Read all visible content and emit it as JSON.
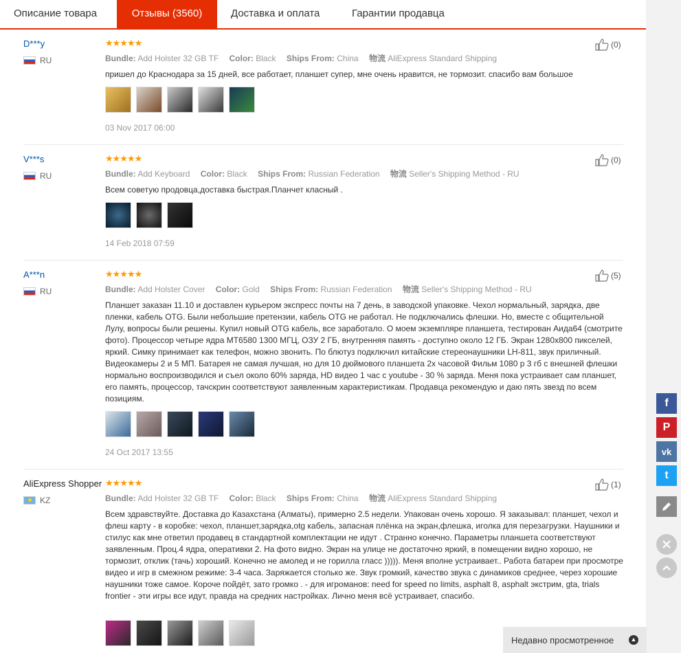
{
  "tabs": [
    {
      "label": "Описание товара"
    },
    {
      "label": "Отзывы (3560)"
    },
    {
      "label": "Доставка и оплата"
    },
    {
      "label": "Гарантии продавца"
    }
  ],
  "labels": {
    "bundle": "Bundle:",
    "color": "Color:",
    "ships_from": "Ships From:",
    "shipping": "物流"
  },
  "stars": "★★★★★",
  "reviews": [
    {
      "name": "D***y",
      "country": "RU",
      "bundle": "Add Holster 32 GB TF",
      "color": "Black",
      "ships_from": "China",
      "shipping": "AliExpress Standard Shipping",
      "text": "пришел до Краснодара за 15 дней, все работает, планшет супер, мне очень нравится, не тормозит. спасибо вам большое",
      "likes": "(0)",
      "date": "03 Nov 2017 06:00"
    },
    {
      "name": "V***s",
      "country": "RU",
      "bundle": "Add Keyboard",
      "color": "Black",
      "ships_from": "Russian Federation",
      "shipping": "Seller's Shipping Method - RU",
      "text": "Всем советую продовца,доставка быстрая.Планчет класный .",
      "likes": "(0)",
      "date": "14 Feb 2018 07:59"
    },
    {
      "name": "A***n",
      "country": "RU",
      "bundle": "Add Holster Cover",
      "color": "Gold",
      "ships_from": "Russian Federation",
      "shipping": "Seller's Shipping Method - RU",
      "text": "Планшет заказан 11.10 и доставлен курьером экспресс почты на 7 день, в заводской упаковке. Чехол нормальный, зарядка, две пленки, кабель OTG. Были небольшие претензии, кабель OTG не работал. Не подключались флешки. Но, вместе с общительной Лулу, вопросы были решены. Купил новый OTG кабель, все заработало. О моем экземпляре планшета, тестирован Аида64 (смотрите фото). Процессор четыре ядра MT6580 1300 МГЦ, ОЗУ 2 ГБ, внутренняя память - доступно около 12 ГБ. Экран 1280x800 пикселей, яркий. Симку принимает как телефон, можно звонить. По блютуз подключил китайские стереонаушники LH-811, звук приличный. Видеокамеры 2 и 5 МП. Батарея не самая лучшая, но для 10 дюймового планшета 2х часовой Фильм 1080 р 3 гб с внешней флешки нормально воспроизводился и съел около 60% заряда, HD видео 1 час с youtube - 30 % заряда. Меня пока устраивает сам планшет, его память, процессор, тачскрин соответствуют заявленным характеристикам. Продавца рекомендую и даю пять звезд по всем позициям.",
      "likes": "(5)",
      "date": "24 Oct 2017 13:55"
    },
    {
      "name": "AliExpress Shopper",
      "country": "KZ",
      "bundle": "Add Holster 32 GB TF",
      "color": "Black",
      "ships_from": "China",
      "shipping": "AliExpress Standard Shipping",
      "text": "Всем здравствуйте. Доставка до Казахстана (Алматы), примерно 2.5 недели. Упакован очень хорошо. Я заказывал: планшет, чехол и флеш карту - в коробке: чехол, планшет,зарядка,otg кабель, запасная плёнка на экран,флешка, иголка для перезагрузки. Наушники и стилус как мне ответил продавец в стандартной комплектации не идут . Странно конечно. Параметры планшета соответствуют заявленным. Проц.4 ядра, оперативки 2. На фото видно. Экран на улице не достаточно яркий, в помещении видно хорошо, не тормозит, отклик (тачь) хороший. Конечно не амолед и не горилла гласс ))))). Меня вполне устраивает.. Работа батареи при просмотре видео и игр в смежном режиме: 3-4 часа. Заряжается столько же. Звук громкий, качество звука с динамиков среднее, через хорошие наушники тоже самое. Короче пойдёт, зато громко . - для игроманов: need for speed no limits, asphalt 8, asphalt экстрим, gta, trials frontier - эти игры все идут, правда на средних настройках. Лично меня всё устраивает, спасибо.",
      "likes": "(1)",
      "date": ""
    }
  ],
  "social": {
    "facebook": "f",
    "pinterest": "P",
    "vk": "vk",
    "twitter": "t"
  },
  "recent_label": "Недавно просмотренное",
  "colors": {
    "accent": "#e62e04",
    "star": "#ff9a00",
    "link": "#0055aa",
    "facebook": "#3b5998",
    "pinterest": "#cb2027",
    "vk": "#4c75a3",
    "twitter": "#1da1f2"
  }
}
